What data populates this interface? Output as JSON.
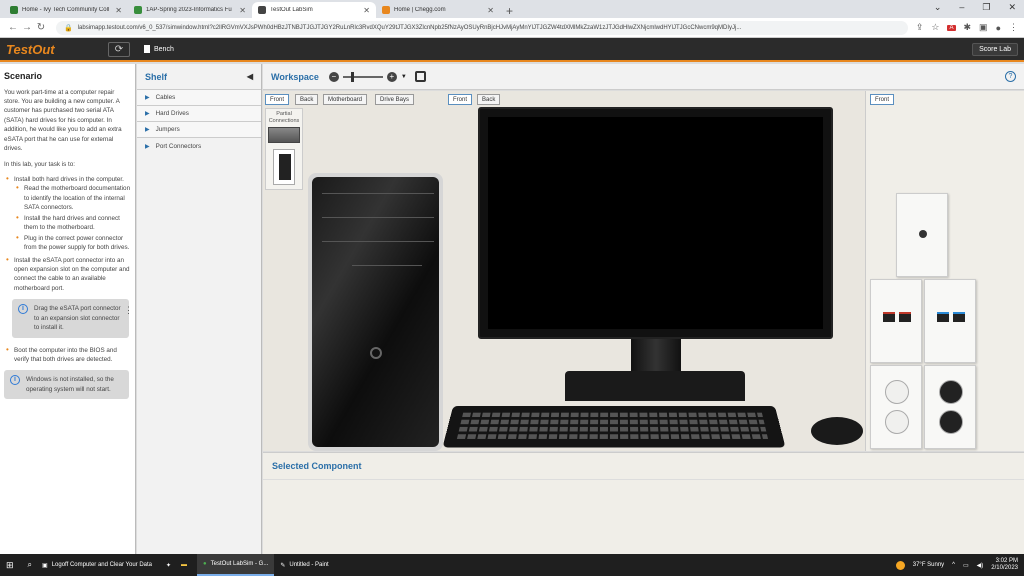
{
  "browser": {
    "tabs": [
      {
        "title": "Home - Ivy Tech Community Coll",
        "fav_color": "#2e7d32",
        "active": false
      },
      {
        "title": "1AP-Spring 2023-Informatics Fu",
        "fav_color": "#388e3c",
        "active": false
      },
      {
        "title": "TestOut LabSim",
        "fav_color": "#444444",
        "active": true
      },
      {
        "title": "Home | Chegg.com",
        "fav_color": "#e8871e",
        "active": false
      }
    ],
    "url": "labsimapp.testout.com/v6_0_537/simwindow.html?c2llRGVmVXJsPWh0dHBzJTNBJTJGJTJGY2RuLnRlc3RvdXQuY29tJTJGX3ZlcnNpb25fNzAyOSUyRnBjcHJvMjAyMnYlJTJGZW4tdXMlMkZzaW1zJTJGdHlwZXNjcmlwdHYlJTJGcCNwcm9qMDIyJj...",
    "back_icon": "arrow-left-icon",
    "forward_icon": "arrow-right-icon",
    "reload_icon": "reload-icon"
  },
  "app": {
    "brand": "TestOut",
    "bench_label": "Bench",
    "score_label": "Score Lab",
    "accent": "#e8871e"
  },
  "scenario": {
    "title": "Scenario",
    "intro": "You work part-time at a computer repair store. You are building a new computer. A customer has purchased two serial ATA (SATA) hard drives for his computer. In addition, he would like you to add an extra eSATA port that he can use for external drives.",
    "task_intro": "In this lab, your task is to:",
    "tasks": [
      {
        "text": "Install both hard drives in the computer.",
        "subtasks": [
          "Read the motherboard documentation to identify the location of the internal SATA connectors.",
          "Install the hard drives and connect them to the motherboard.",
          "Plug in the correct power connector from the power supply for both drives."
        ]
      },
      {
        "text": "Install the eSATA port connector into an open expansion slot on the computer and connect the cable to an available motherboard port.",
        "subtasks": []
      }
    ],
    "hint1": "Drag the eSATA port connector to an expansion slot connector to install it.",
    "task3": "Boot the computer into the BIOS and verify that both drives are detected.",
    "hint2": "Windows is not installed, so the operating system will not start."
  },
  "shelf": {
    "title": "Shelf",
    "items": [
      "Cables",
      "Hard Drives",
      "Jumpers",
      "Port Connectors"
    ]
  },
  "workspace": {
    "title": "Workspace",
    "views_left": [
      "Front",
      "Back",
      "Motherboard",
      "Drive Bays"
    ],
    "views_mid": [
      "Front",
      "Back"
    ],
    "views_right": [
      "Front"
    ],
    "partial_label": "Partial Connections",
    "selected_component": "Selected Component"
  },
  "taskbar": {
    "items": [
      "Logoff Computer and Clear Your Data",
      "TestOut LabSim - G...",
      "Untitled - Paint"
    ],
    "weather": "37°F Sunny",
    "time": "3:02 PM",
    "date": "2/10/2023"
  }
}
